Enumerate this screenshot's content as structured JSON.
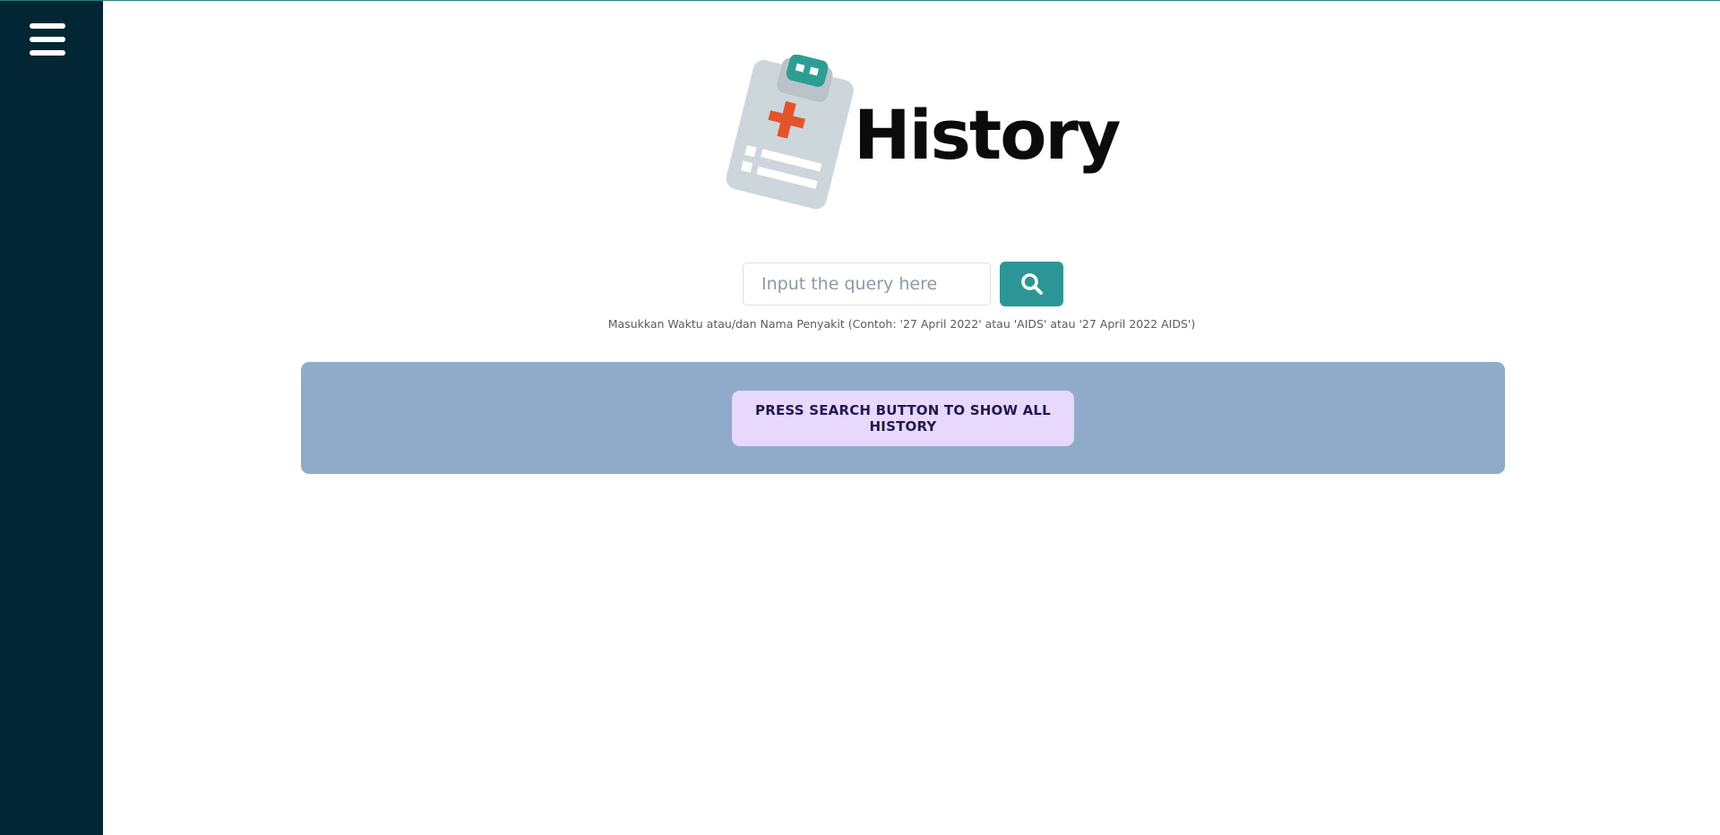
{
  "sidebar": {
    "menu_icon": "hamburger-menu-icon"
  },
  "logo": {
    "icon": "medical-clipboard-icon",
    "title": "History"
  },
  "search": {
    "placeholder": "Input the query here",
    "value": "",
    "button_icon": "search-icon",
    "hint": "Masukkan Waktu atau/dan Nama Penyakit (Contoh: '27 April 2022' atau 'AIDS' atau '27 April 2022 AIDS')"
  },
  "results": {
    "show_all_label": "PRESS SEARCH BUTTON TO SHOW ALL HISTORY"
  },
  "colors": {
    "sidebar": "#022634",
    "accent": "#2c9696",
    "panel": "#90abca",
    "button": "#e8d8fb",
    "button_text": "#1f1a4e"
  }
}
